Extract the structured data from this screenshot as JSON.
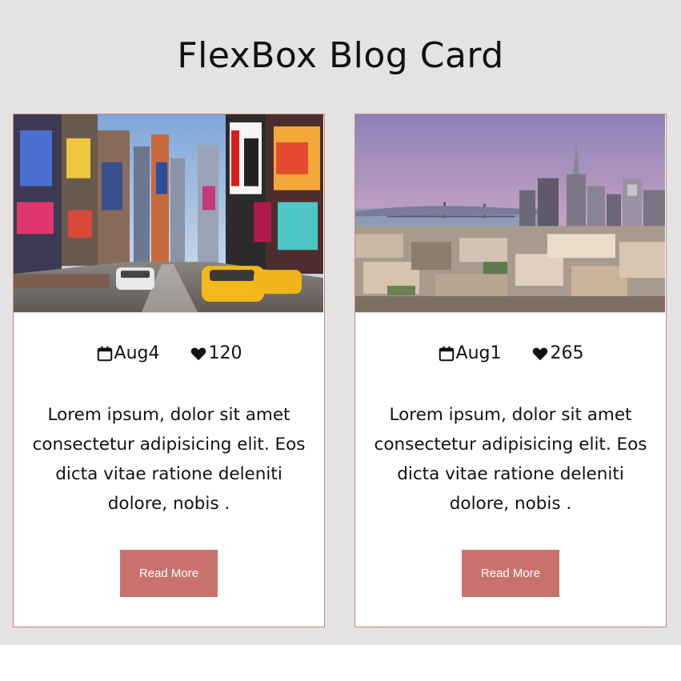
{
  "page": {
    "title": "FlexBox Blog Card"
  },
  "colors": {
    "background": "#e4e2e3",
    "card_border": "#c98783",
    "button": "#c9726d",
    "button_text": "#ffffff"
  },
  "cards": [
    {
      "image": "times-square-street-photo",
      "date": "Aug4",
      "likes": "120",
      "date_icon": "calendar-icon",
      "likes_icon": "heart-icon",
      "excerpt": "Lorem ipsum, dolor sit amet consectetur adipisicing elit. Eos dicta vitae ratione deleniti dolore, nobis .",
      "button_label": "Read More"
    },
    {
      "image": "city-skyline-photo",
      "date": "Aug1",
      "likes": "265",
      "date_icon": "calendar-icon",
      "likes_icon": "heart-icon",
      "excerpt": "Lorem ipsum, dolor sit amet consectetur adipisicing elit. Eos dicta vitae ratione deleniti dolore, nobis .",
      "button_label": "Read More"
    }
  ]
}
